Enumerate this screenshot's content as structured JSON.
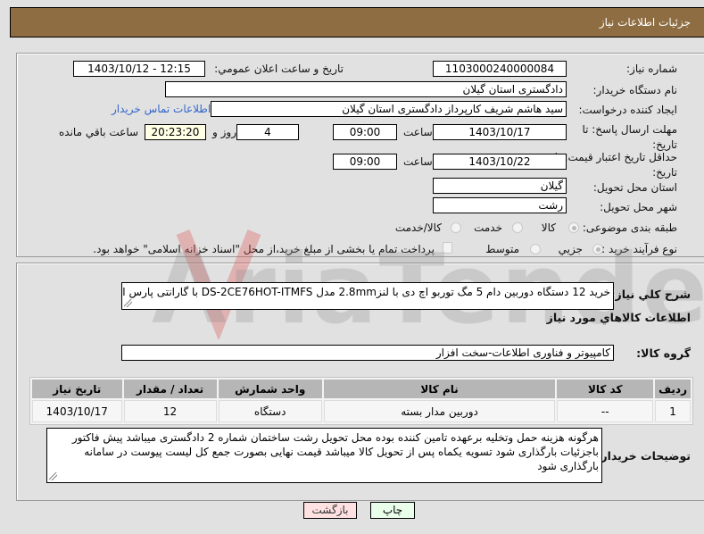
{
  "header": {
    "title": "جزئیات اطلاعات نیاز"
  },
  "watermark": {
    "text": "AriaTender.neT"
  },
  "need_info": {
    "need_number": {
      "label": "شماره نیاز:",
      "value": "1103000240000084"
    },
    "announce_datetime": {
      "label": "تاریخ و ساعت اعلان عمومي:",
      "value": "1403/10/12 - 12:15"
    },
    "buyer_org": {
      "label": "نام دستگاه خریدار:",
      "value": "دادگستری استان گیلان"
    },
    "requester": {
      "label": "ایجاد کننده درخواست:",
      "value": "سید هاشم شریف کارپرداز دادگستری استان گیلان"
    },
    "buyer_contact_link": "اطلاعات تماس خریدار",
    "response_deadline": {
      "label": "مهلت ارسال پاسخ: تا تاریخ:",
      "date": "1403/10/17",
      "time_label": "ساعت",
      "time": "09:00",
      "days": "4",
      "days_label": "روز و",
      "remaining_time": "20:23:20",
      "remaining_label": "ساعت باقي مانده"
    },
    "price_validity": {
      "label": "حداقل تاریخ اعتبار قیمت: تا تاریخ:",
      "date": "1403/10/22",
      "time_label": "ساعت",
      "time": "09:00"
    },
    "delivery_province": {
      "label": "استان محل تحویل:",
      "value": "گیلان"
    },
    "delivery_city": {
      "label": "شهر محل تحویل:",
      "value": "رشت"
    },
    "category": {
      "label": "طبقه بندی موضوعی:",
      "options": [
        "کالا",
        "خدمت",
        "کالا/خدمت"
      ],
      "selected": "کالا"
    },
    "purchase_type": {
      "label": "نوع فرآیند خرید :",
      "options": [
        "جزیي",
        "متوسط"
      ],
      "selected": "جزیي",
      "treasury_checkbox_label": "پرداخت تمام یا بخشی از مبلغ خرید،از محل \"اسناد خزانه اسلامی\" خواهد بود.",
      "treasury_checked": false
    }
  },
  "details": {
    "description": {
      "label": "شرح کلي نیاز:",
      "value": "خرید 12 دستگاه دوربین دام 5 مگ توربو اچ دی با لنز2.8mm مدل DS-2CE76HOT-ITMFS با گارانتی پارس ارتباط"
    },
    "goods_section_title": "اطلاعات کالاهاي مورد نیاز",
    "goods_group": {
      "label": "گروه کالا:",
      "value": "کامپیوتر و فناوری اطلاعات-سخت افزار"
    },
    "table": {
      "headers": [
        "ردیف",
        "کد کالا",
        "نام کالا",
        "واحد شمارش",
        "تعداد / مقدار",
        "تاریخ نیاز"
      ],
      "rows": [
        [
          "1",
          "--",
          "دوربین مدار بسته",
          "دستگاه",
          "12",
          "1403/10/17"
        ]
      ]
    },
    "buyer_notes": {
      "label": "توضیحات خریدار:",
      "value": "هرگونه هزینه حمل وتخلیه برعهده تامین کننده بوده محل تحویل رشت ساختمان شماره 2 دادگستری میباشد پیش فاکتور باجزئیات بارگذاری شود تسویه یکماه پس از تحویل کالا میباشد  قیمت نهایی بصورت جمع کل لیست پیوست در سامانه بارگذاری شود"
    }
  },
  "actions": {
    "print_label": "چاپ",
    "back_label": "بازگشت"
  }
}
